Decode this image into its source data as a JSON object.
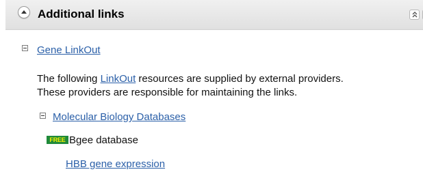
{
  "section": {
    "title": "Additional links",
    "help_glyph": "?"
  },
  "gene_linkout": {
    "label": "Gene LinkOut",
    "intro_before": "The following ",
    "intro_link": "LinkOut",
    "intro_after": " resources are supplied by external providers.",
    "intro_line2": "These providers are responsible for maintaining the links."
  },
  "category": {
    "label": "Molecular Biology Databases"
  },
  "provider": {
    "badge": "FREE",
    "name": "Bgee database",
    "link": "HBB gene expression"
  },
  "colors": {
    "link": "#2a5fa8",
    "header_bg": "#e6e6e6",
    "badge_bg": "#1f8a3a",
    "badge_text": "#f5f000"
  }
}
